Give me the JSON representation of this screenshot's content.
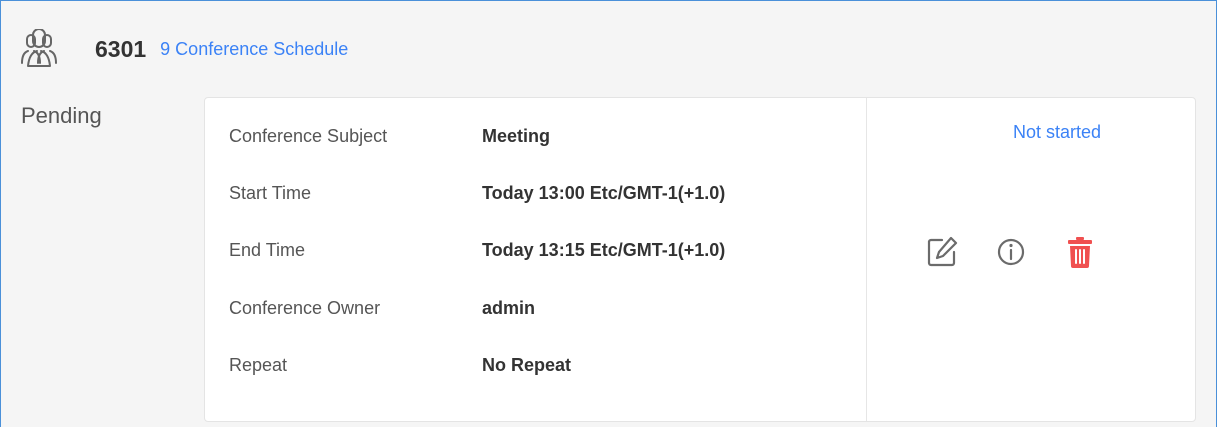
{
  "header": {
    "room_number": "6301",
    "schedule_link": "9 Conference Schedule",
    "icon": "conference-users-icon"
  },
  "section": {
    "status_label": "Pending"
  },
  "conference": {
    "details": [
      {
        "label": "Conference Subject",
        "value": "Meeting"
      },
      {
        "label": "Start Time",
        "value": "Today 13:00 Etc/GMT-1(+1.0)"
      },
      {
        "label": "End Time",
        "value": "Today 13:15 Etc/GMT-1(+1.0)"
      },
      {
        "label": "Conference Owner",
        "value": "admin"
      },
      {
        "label": "Repeat",
        "value": "No Repeat"
      }
    ],
    "state": "Not started",
    "actions": [
      {
        "name": "edit",
        "icon": "edit-icon"
      },
      {
        "name": "info",
        "icon": "info-icon"
      },
      {
        "name": "delete",
        "icon": "trash-icon"
      }
    ]
  },
  "colors": {
    "accent": "#3b82f6",
    "delete": "#f05050",
    "frame_border": "#4a90d9"
  }
}
